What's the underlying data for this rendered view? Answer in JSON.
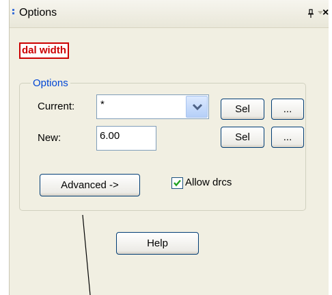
{
  "window": {
    "title": "Options"
  },
  "field_label": "dal width",
  "options_group": {
    "caption": "Options",
    "current_label": "Current:",
    "current_value": "*",
    "new_label": "New:",
    "new_value": "6.00",
    "sel_label": "Sel",
    "browse_label": "...",
    "advanced_label": "Advanced ->",
    "allow_drcs_label": "Allow drcs",
    "allow_drcs_checked": true
  },
  "help_label": "Help",
  "colors": {
    "panel_bg": "#f1efe2",
    "field_label_red": "#cc0000",
    "group_caption_blue": "#0046d5",
    "checkmark_green": "#21a121"
  },
  "icons": [
    "pin-icon",
    "dropdown-icon",
    "close-icon",
    "chevron-down-icon",
    "checkmark-icon"
  ]
}
